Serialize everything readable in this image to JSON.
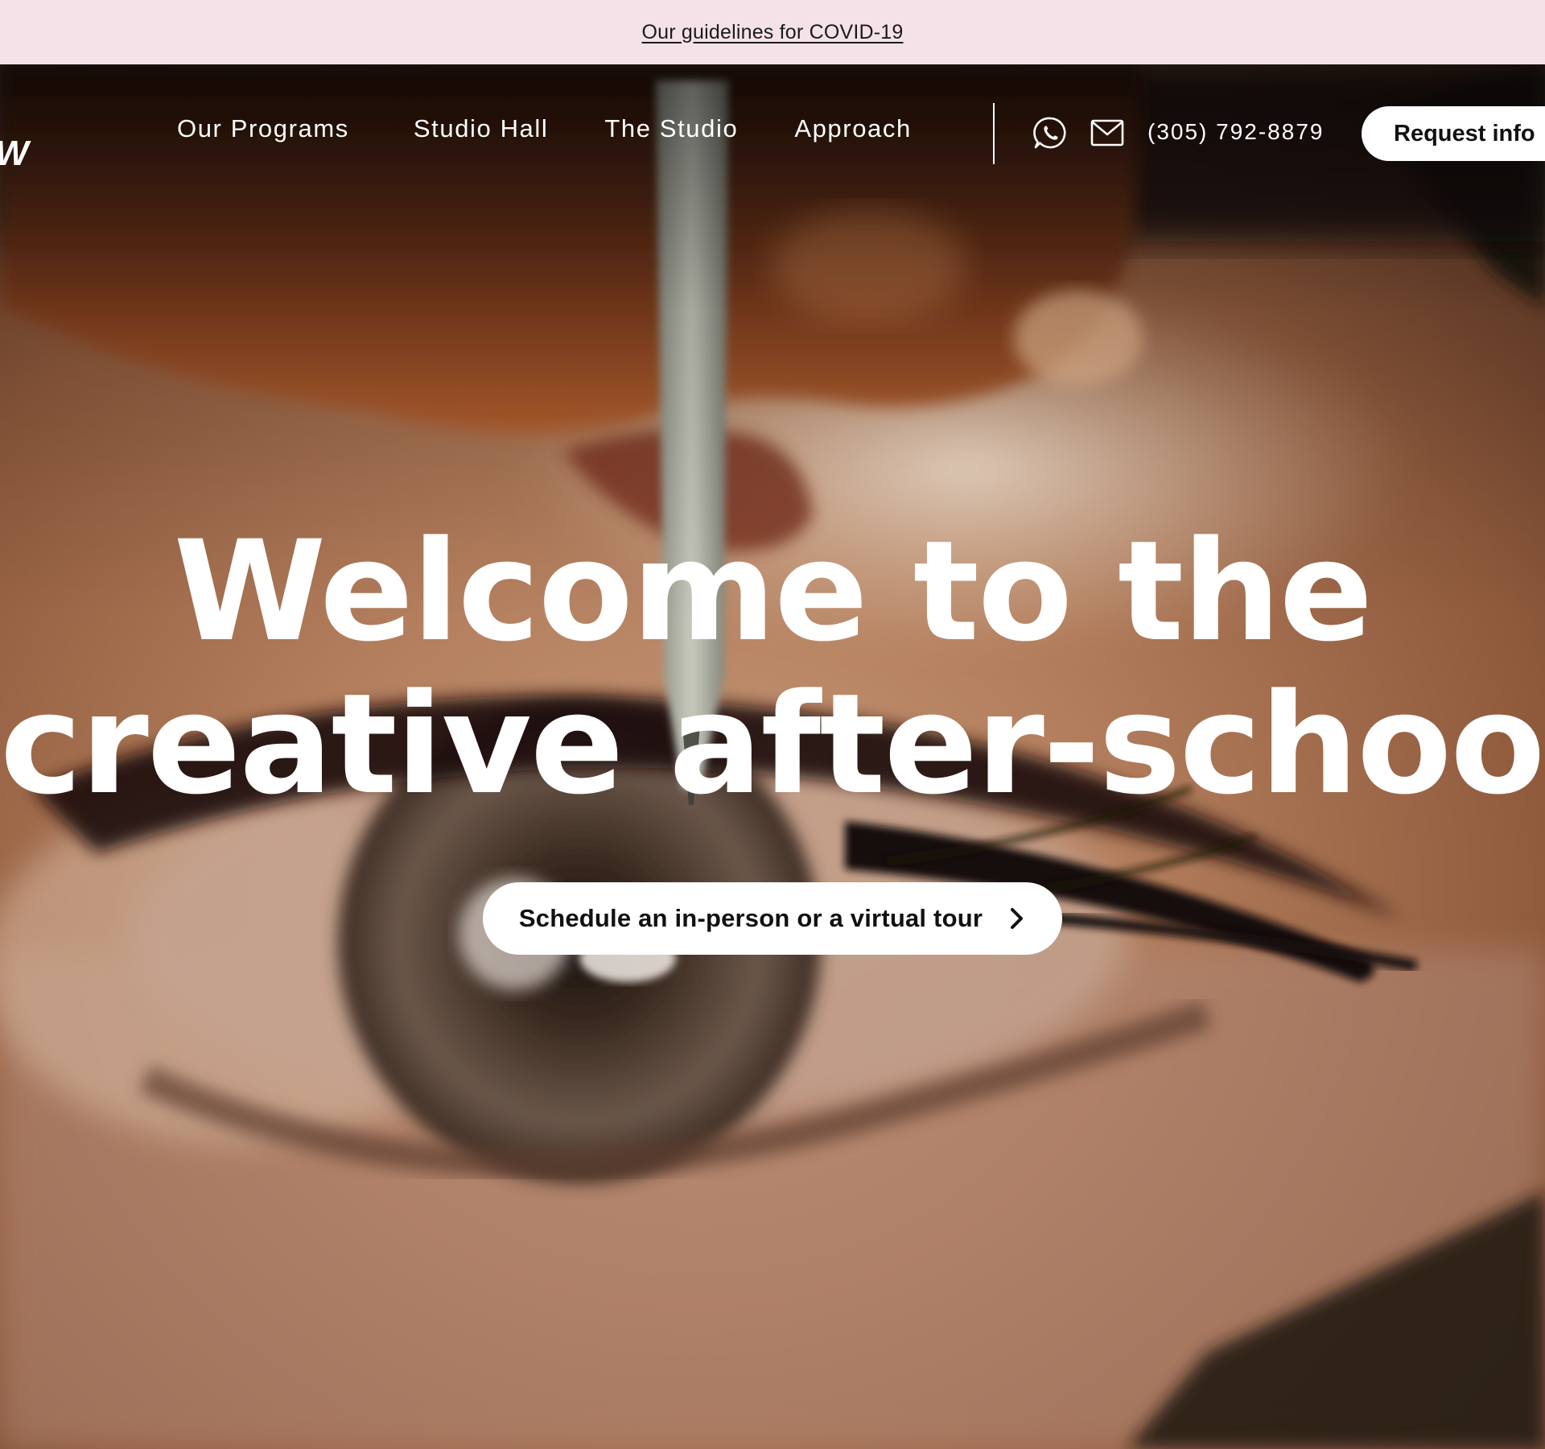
{
  "announcement": {
    "link_text": "Our guidelines for COVID-19"
  },
  "nav": {
    "logo_fragment": "W",
    "links": [
      "Our Programs",
      "Studio Hall",
      "The Studio",
      "Approach"
    ],
    "whatsapp_icon": "whatsapp-icon",
    "mail_icon": "mail-icon",
    "phone": "(305) 792-8879",
    "request_button": "Request info"
  },
  "hero": {
    "headline_line1": "Welcome to the",
    "headline_line2": "creative after-school.",
    "cta_label": "Schedule an in-person or a virtual tour",
    "cta_icon": "chevron-right-icon",
    "background_image": "close-up of a hand drawing an eye with a stylus"
  },
  "colors": {
    "announcement_bg": "#f4e2e8",
    "text_light": "#ffffff",
    "button_bg": "#ffffff",
    "button_text": "#111111"
  }
}
